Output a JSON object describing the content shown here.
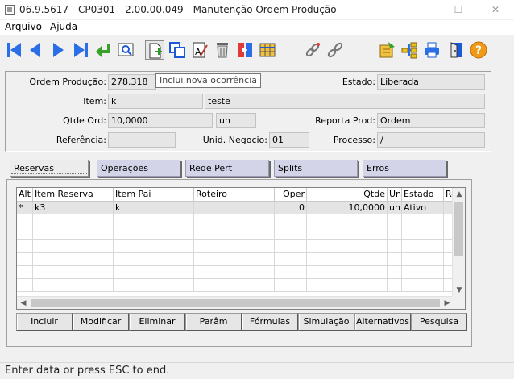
{
  "window": {
    "title": "06.9.5617 - CP0301 - 2.00.00.049 - Manutenção Ordem Produção",
    "minimize": "—",
    "maximize": "☐",
    "close": "✕"
  },
  "menu": {
    "items": [
      "Arquivo",
      "Ajuda"
    ]
  },
  "toolbar": {
    "buttons": [
      "first-record",
      "previous-record",
      "next-record",
      "last-record",
      "return",
      "view",
      "new-occurrence",
      "copy",
      "edit-text",
      "delete",
      "switch",
      "grid-view",
      "link",
      "unlink",
      "notes",
      "hierarchy",
      "print",
      "exit",
      "help"
    ],
    "tooltip": "Inclui nova ocorrência"
  },
  "header": {
    "ordem_label": "Ordem Produção:",
    "ordem_value": "278.318",
    "estado_label": "Estado:",
    "estado_value": "Liberada",
    "item_label": "Item:",
    "item_value": "k",
    "item_desc": "teste",
    "qtde_label": "Qtde Ord:",
    "qtde_value": "10,0000",
    "qtde_unit": "un",
    "reporta_label": "Reporta Prod:",
    "reporta_value": "Ordem",
    "referencia_label": "Referência:",
    "referencia_value": "",
    "unid_label": "Unid. Negocio:",
    "unid_value": "01",
    "processo_label": "Processo:",
    "processo_value": "/"
  },
  "tabs": [
    "Reservas",
    "Operações",
    "Rede Pert",
    "Splits",
    "Erros"
  ],
  "grid": {
    "columns": [
      "Alt",
      "Item Reserva",
      "Item Pai",
      "Roteiro",
      "Oper",
      "Qtde",
      "Un",
      "Estado",
      "Re"
    ],
    "rows": [
      [
        "*",
        "k3",
        "k",
        "",
        "0",
        "10,0000",
        "un",
        "Ativo",
        ""
      ]
    ]
  },
  "actions": [
    "Incluir",
    "Modificar",
    "Eliminar",
    "Parâm",
    "Fórmulas",
    "Simulação",
    "Alternativos",
    "Pesquisa"
  ],
  "status": {
    "text": "Enter data or press ESC to end."
  },
  "colors": {
    "toolbar_blue": "#2a6ee8",
    "toolbar_green": "#3aa02a",
    "tab_inactive": "#d4d4e8",
    "help_orange": "#f09a1a"
  }
}
